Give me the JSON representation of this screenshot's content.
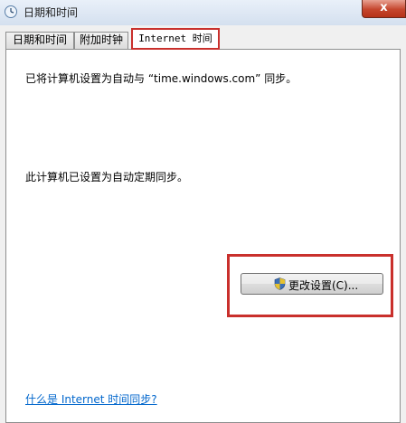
{
  "window": {
    "title": "日期和时间",
    "close_label": "x"
  },
  "tabs": [
    {
      "label": "日期和时间"
    },
    {
      "label": "附加时钟"
    },
    {
      "label": "Internet 时间"
    }
  ],
  "panel": {
    "sync_server_text": "已将计算机设置为自动与 “time.windows.com” 同步。",
    "schedule_text": "此计算机已设置为自动定期同步。",
    "change_settings_label": "更改设置(C)...",
    "help_link": "什么是 Internet 时间同步?"
  }
}
